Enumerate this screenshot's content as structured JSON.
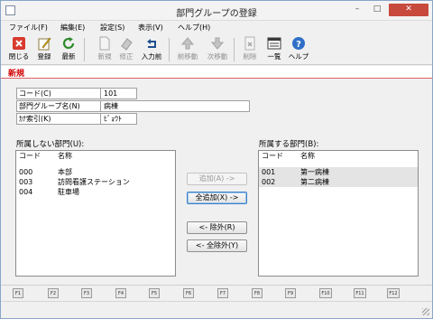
{
  "window": {
    "title": "部門グループの登録",
    "minimize": "–",
    "maximize": "□",
    "close": "✕"
  },
  "menu": [
    "ファイル(F)",
    "編集(E)",
    "設定(S)",
    "表示(V)",
    "ヘルプ(H)"
  ],
  "toolbar": {
    "close": "閉じる",
    "register": "登録",
    "latest": "最新",
    "new": "新規",
    "edit": "修正",
    "input_before": "入力前",
    "prev_move": "前移動",
    "next_move": "次移動",
    "delete": "削除",
    "list": "一覧",
    "help": "ヘルプ"
  },
  "mode": "新規",
  "form": {
    "code_label": "コード(C)",
    "code_value": "101",
    "group_name_label": "部門グループ名(N)",
    "group_name_value": "病棟",
    "kana_label": "ｶﾅ索引(K)",
    "kana_value": "ﾋﾞｮｳﾄ"
  },
  "left_list": {
    "caption": "所属しない部門(U):",
    "header_code": "コード",
    "header_name": "名称",
    "rows": [
      {
        "code": "000",
        "name": "本部"
      },
      {
        "code": "003",
        "name": "訪問看護ステーション"
      },
      {
        "code": "004",
        "name": "駐車場"
      }
    ]
  },
  "right_list": {
    "caption": "所属する部門(B):",
    "header_code": "コード",
    "header_name": "名称",
    "rows": [
      {
        "code": "001",
        "name": "第一病棟"
      },
      {
        "code": "002",
        "name": "第二病棟"
      }
    ]
  },
  "buttons": {
    "add": "追加(A) ->",
    "add_all": "全追加(X) ->",
    "remove": "<- 除外(R)",
    "remove_all": "<- 全除外(Y)"
  },
  "fkeys": [
    "F1",
    "F2",
    "F3",
    "F4",
    "F5",
    "F6",
    "F7",
    "F8",
    "F9",
    "F10",
    "F11",
    "F12"
  ]
}
